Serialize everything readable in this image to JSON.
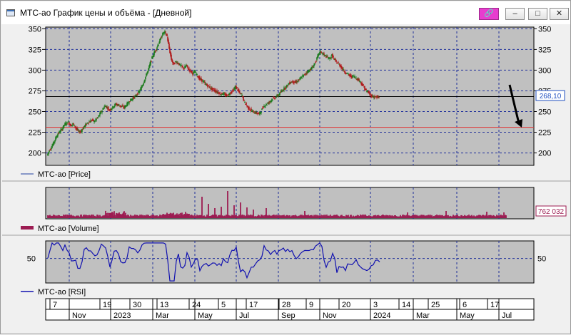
{
  "window": {
    "title": "МТС-ао График цены и объёма - [Дневной]",
    "buttons": {
      "pin": "🔗",
      "minimize": "–",
      "maximize": "□",
      "close": "✕"
    }
  },
  "chart_data": [
    {
      "type": "line",
      "panel": "price",
      "legend": "МТС-ао [Price]",
      "ylim": [
        185,
        352
      ],
      "yticks": [
        200,
        225,
        250,
        275,
        300,
        325,
        350
      ],
      "last_value_label": "268,10",
      "hlines": [
        {
          "value": 268.1,
          "color": "#000000"
        },
        {
          "value": 231,
          "color": "#e03030"
        }
      ],
      "x": [
        0,
        3,
        6,
        9,
        12,
        15,
        18,
        21,
        24,
        27,
        30,
        33,
        36,
        39,
        42,
        45,
        48,
        51,
        54,
        57,
        60,
        63,
        66,
        69,
        72,
        75,
        78,
        81,
        84,
        87,
        90,
        93,
        96,
        99,
        102,
        105,
        108,
        111,
        114,
        117,
        120,
        123,
        126,
        129,
        132,
        135,
        138,
        141,
        144,
        147,
        150,
        153,
        156,
        159,
        162,
        165,
        168,
        171,
        174,
        177,
        180,
        183,
        186,
        189,
        192,
        195,
        198,
        201,
        204,
        207,
        210,
        213,
        216,
        219,
        222,
        225,
        228,
        231,
        234,
        237,
        240,
        243,
        246,
        249,
        252,
        255,
        258,
        261,
        264,
        267,
        270,
        273,
        276,
        279,
        282,
        285,
        288,
        291,
        294,
        297,
        300,
        303,
        306,
        309,
        312,
        315,
        318,
        321,
        324,
        327,
        330,
        333,
        336,
        339,
        342,
        345,
        348,
        351,
        354,
        357,
        360,
        363,
        366,
        369,
        372,
        375,
        378,
        381,
        384,
        387,
        390,
        393,
        396,
        399,
        402,
        405,
        408,
        411,
        414,
        417,
        420,
        423,
        426,
        429,
        432,
        435,
        438,
        441,
        444,
        447,
        450,
        453,
        456,
        459,
        462,
        465,
        468,
        471,
        474,
        477,
        480,
        483,
        486,
        489,
        492,
        495,
        498,
        501,
        504,
        507,
        510,
        513,
        516,
        519,
        522,
        525,
        528,
        531,
        534,
        537,
        540,
        543,
        546,
        549,
        552,
        555,
        558,
        561,
        564,
        567,
        570,
        573,
        576,
        579,
        582,
        585,
        588,
        591,
        594,
        597,
        600,
        603,
        606,
        609,
        612,
        615,
        618,
        621,
        624,
        627,
        630,
        633,
        636,
        639,
        642
      ],
      "values": [
        197,
        203,
        207,
        212,
        218,
        223,
        226,
        229,
        234,
        236,
        237,
        233,
        235,
        232,
        228,
        225,
        227,
        231,
        234,
        237,
        238,
        240,
        238,
        241,
        244,
        249,
        253,
        257,
        255,
        252,
        254,
        256,
        259,
        258,
        257,
        256,
        255,
        258,
        261,
        264,
        266,
        268,
        271,
        274,
        279,
        285,
        292,
        299,
        307,
        315,
        321,
        326,
        332,
        338,
        344,
        346,
        341,
        326,
        313,
        307,
        310,
        309,
        306,
        304,
        302,
        306,
        301,
        299,
        296,
        298,
        294,
        290,
        288,
        286,
        283,
        281,
        279,
        277,
        276,
        274,
        273,
        271,
        272,
        270,
        269,
        271,
        274,
        276,
        280,
        276,
        272,
        270,
        262,
        258,
        254,
        252,
        250,
        249,
        248,
        247,
        251,
        256,
        258,
        260,
        262,
        265,
        266,
        268,
        270,
        273,
        276,
        279,
        281,
        284,
        286,
        286,
        285,
        287,
        289,
        292,
        294,
        297,
        299,
        301,
        304,
        308,
        314,
        321,
        322,
        319,
        317,
        315,
        314,
        318,
        313,
        310,
        308,
        305,
        301,
        298,
        296,
        294,
        292,
        293,
        291,
        289,
        287,
        283,
        279,
        275,
        273,
        270,
        268,
        268,
        267,
        267
      ],
      "x_note": "indices in trading days"
    },
    {
      "type": "bar",
      "panel": "volume",
      "legend": "МТС-ао [Volume]",
      "last_value_label": "762 032"
    },
    {
      "type": "line",
      "panel": "rsi",
      "legend": "МТС-ао [RSI]",
      "yticks": [
        50
      ],
      "ylim": [
        15,
        75
      ]
    }
  ],
  "time_axis": {
    "days": [
      "7",
      "19",
      "30",
      "13",
      "24",
      "5",
      "17",
      "28",
      "9",
      "20",
      "3",
      "14",
      "25",
      "6",
      "17"
    ],
    "months": [
      "Nov",
      "2023",
      "Mar",
      "May",
      "Jul",
      "Sep",
      "Nov",
      "2024",
      "Mar",
      "May",
      "Jul"
    ]
  }
}
